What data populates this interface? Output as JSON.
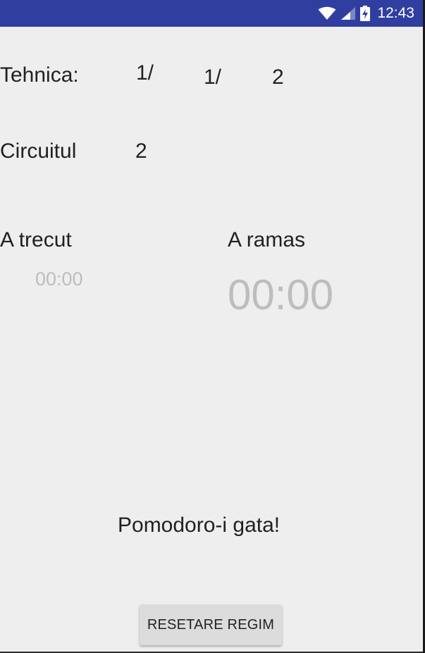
{
  "status_bar": {
    "time": "12:43",
    "bar_color": "#303f9f",
    "icons": [
      "wifi-icon",
      "signal-icon",
      "battery-charging-icon"
    ]
  },
  "technique": {
    "label": "Tehnica:",
    "value_1": "1/",
    "value_2": "1/",
    "value_3": "2"
  },
  "circuit": {
    "label": "Circuitul",
    "value": "2"
  },
  "elapsed": {
    "label": "A trecut",
    "time": "00:00"
  },
  "remaining": {
    "label": "A ramas",
    "time": "00:00"
  },
  "status_message": "Pomodoro-i gata!",
  "reset_button": {
    "label": "RESETARE REGIM"
  },
  "colors": {
    "background": "#eeeeee",
    "text": "#212121",
    "timer_muted": "#bdbdbd",
    "button": "#dcdcdc"
  }
}
